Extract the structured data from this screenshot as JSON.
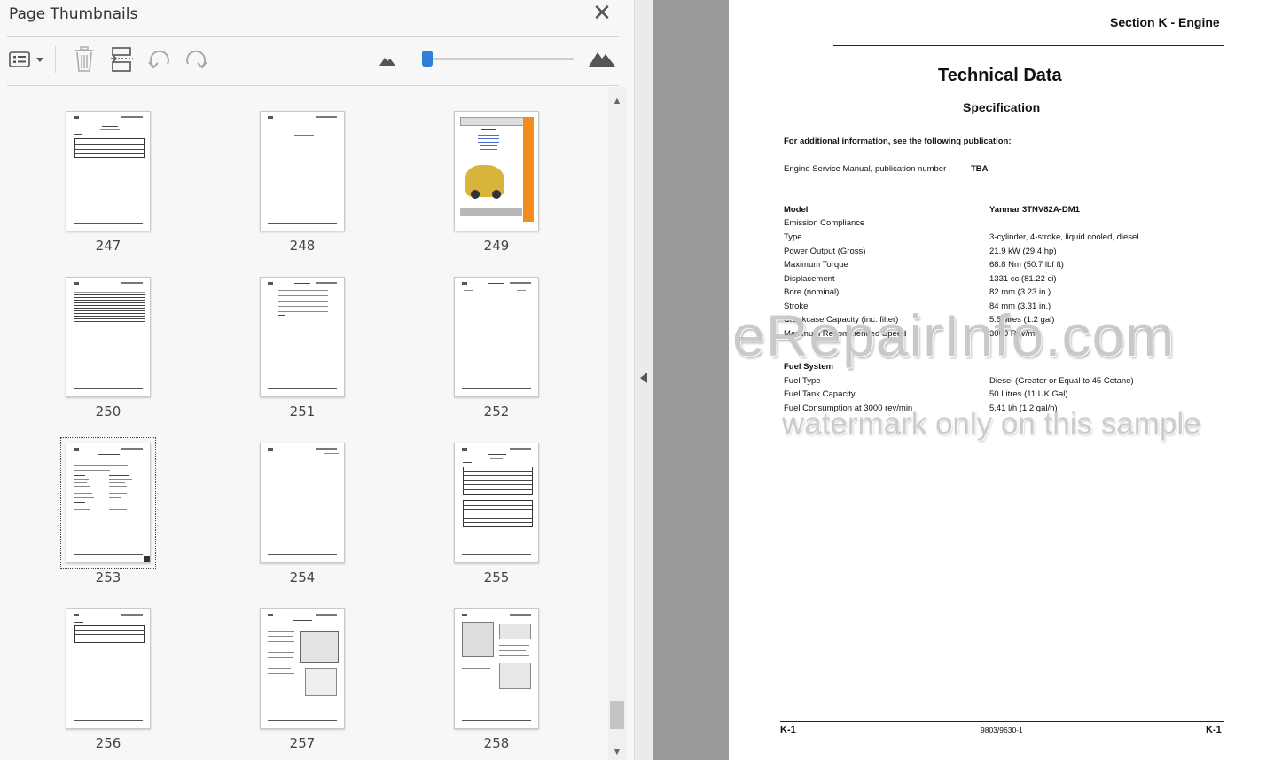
{
  "panel": {
    "title": "Page Thumbnails",
    "toolbar": {
      "options_icon": "list-options-icon",
      "delete_icon": "trash-icon",
      "insert_icon": "insert-pages-icon",
      "rotate_ccw_icon": "rotate-counterclockwise-icon",
      "rotate_cw_icon": "rotate-clockwise-icon",
      "zoom_out_icon": "mountain-small-icon",
      "zoom_in_icon": "mountain-large-icon"
    },
    "zoom_level": 0.02,
    "selected_page": "253",
    "thumbnails": [
      {
        "page": "247"
      },
      {
        "page": "248"
      },
      {
        "page": "249"
      },
      {
        "page": "250"
      },
      {
        "page": "251"
      },
      {
        "page": "252"
      },
      {
        "page": "253"
      },
      {
        "page": "254"
      },
      {
        "page": "255"
      },
      {
        "page": "256"
      },
      {
        "page": "257"
      },
      {
        "page": "258"
      }
    ]
  },
  "document": {
    "section": "Section K - Engine",
    "title": "Technical Data",
    "subtitle": "Specification",
    "additional_info": "For additional information, see the following publication:",
    "manual_label": "Engine Service Manual, publication number",
    "manual_value": "TBA",
    "specs": [
      {
        "label": "Model",
        "value": "Yanmar 3TNV82A-DM1",
        "bold": true
      },
      {
        "label": "Emission Compliance",
        "value": ""
      },
      {
        "label": "Type",
        "value": "3-cylinder, 4-stroke, liquid cooled, diesel"
      },
      {
        "label": "Power Output (Gross)",
        "value": "21.9 kW (29.4 hp)"
      },
      {
        "label": "Maximum Torque",
        "value": "68.8 Nm (50.7 lbf ft)"
      },
      {
        "label": "Displacement",
        "value": "1331 cc (81.22 ci)"
      },
      {
        "label": "Bore (nominal)",
        "value": "82 mm (3.23 in.)"
      },
      {
        "label": "Stroke",
        "value": "84 mm (3.31 in.)"
      },
      {
        "label": "Crankcase Capacity (inc. filter)",
        "value": "5.5 litres (1.2 gal)"
      },
      {
        "label": "Maximum Recommended Speed",
        "value": "3000 Rev/min"
      }
    ],
    "fuel_heading": "Fuel System",
    "fuel_specs": [
      {
        "label": "Fuel Type",
        "value": "Diesel (Greater or Equal to 45 Cetane)"
      },
      {
        "label": "Fuel Tank Capacity",
        "value": "50 Litres (11 UK Gal)"
      },
      {
        "label": "Fuel Consumption at 3000 rev/min",
        "value": "5.41 l/h (1.2 gal/h)"
      }
    ],
    "footer_left": "K-1",
    "footer_center": "9803/9630-1",
    "footer_right": "K-1"
  },
  "watermark": {
    "line1": "eRepairInfo.com",
    "line2": "watermark only on this sample"
  }
}
